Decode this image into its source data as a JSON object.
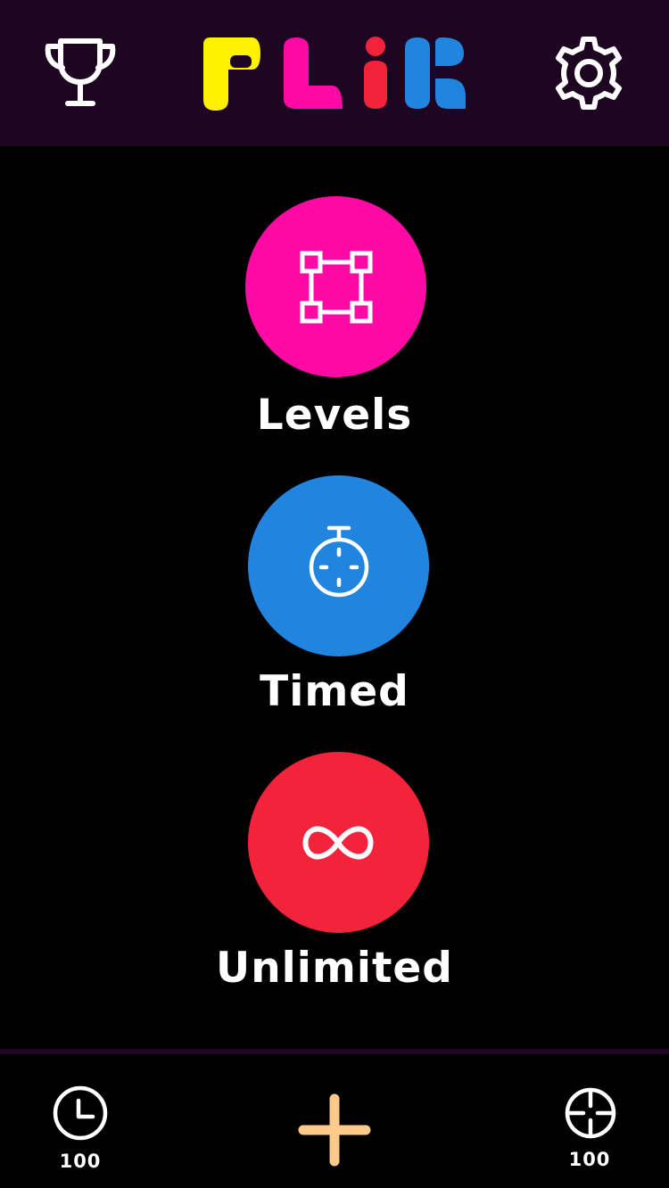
{
  "header": {
    "logo_text": "FLiK",
    "background_color": "#1e0522",
    "logo_colors": [
      "#fff200",
      "#ff0aa5",
      "#f2233a",
      "#2185e0"
    ]
  },
  "modes": [
    {
      "label": "Levels",
      "color": "#ff0aa5",
      "icon": "square-nodes-icon"
    },
    {
      "label": "Timed",
      "color": "#2185e0",
      "icon": "stopwatch-icon"
    },
    {
      "label": "Unlimited",
      "color": "#f2233a",
      "icon": "infinity-icon"
    }
  ],
  "footer": {
    "time_value": "100",
    "target_value": "100",
    "plus_color": "#ffc98a"
  }
}
